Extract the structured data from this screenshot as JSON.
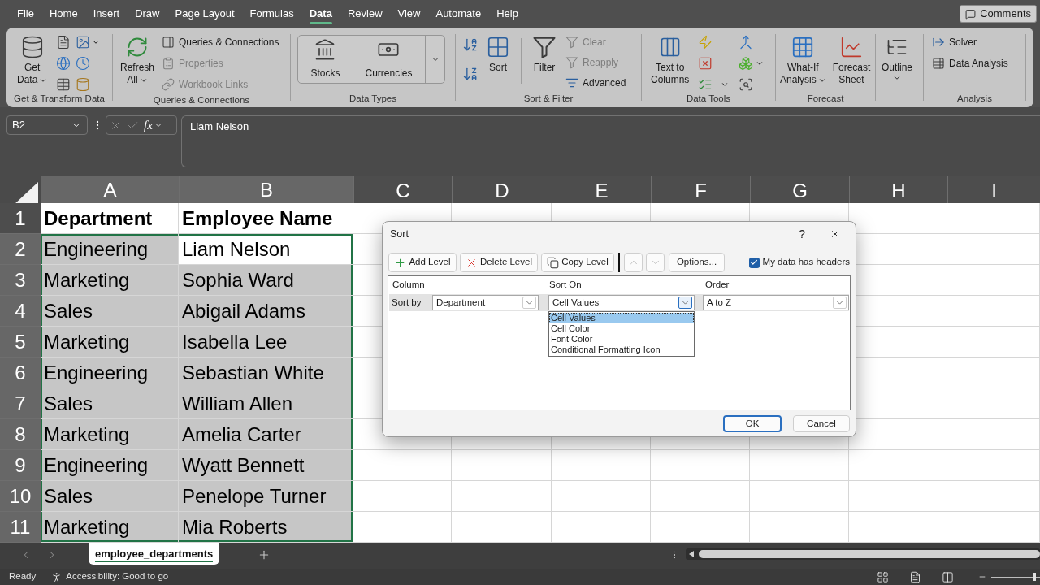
{
  "menu_tabs": [
    {
      "label": "File",
      "selected": false
    },
    {
      "label": "Home",
      "selected": false
    },
    {
      "label": "Insert",
      "selected": false
    },
    {
      "label": "Draw",
      "selected": false
    },
    {
      "label": "Page Layout",
      "selected": false
    },
    {
      "label": "Formulas",
      "selected": false
    },
    {
      "label": "Data",
      "selected": true
    },
    {
      "label": "Review",
      "selected": false
    },
    {
      "label": "View",
      "selected": false
    },
    {
      "label": "Automate",
      "selected": false
    },
    {
      "label": "Help",
      "selected": false
    }
  ],
  "comments_button": "Comments",
  "ribbon": {
    "groups": [
      {
        "label": "Get & Transform Data",
        "buttons": [
          {
            "kind": "large",
            "lines": [
              "Get",
              "Data"
            ],
            "menu": true
          }
        ]
      },
      {
        "label": "Queries & Connections",
        "buttons": [
          {
            "kind": "large",
            "lines": [
              "Refresh",
              "All"
            ],
            "menu": true
          },
          {
            "kind": "small",
            "label": "Queries & Connections",
            "disabled": false
          },
          {
            "kind": "small",
            "label": "Properties",
            "disabled": true
          },
          {
            "kind": "small",
            "label": "Workbook Links",
            "disabled": true
          }
        ]
      },
      {
        "label": "Data Types",
        "buttons": [
          {
            "kind": "gallery",
            "label": "Stocks"
          },
          {
            "kind": "gallery",
            "label": "Currencies"
          }
        ]
      },
      {
        "label": "Sort & Filter",
        "buttons": [
          {
            "kind": "large",
            "lines": [
              "Sort"
            ],
            "menu": false
          },
          {
            "kind": "large",
            "lines": [
              "Filter"
            ],
            "menu": false
          },
          {
            "kind": "small",
            "label": "Clear",
            "disabled": true
          },
          {
            "kind": "small",
            "label": "Reapply",
            "disabled": true
          },
          {
            "kind": "small",
            "label": "Advanced",
            "disabled": false
          }
        ]
      },
      {
        "label": "Data Tools",
        "buttons": [
          {
            "kind": "large",
            "lines": [
              "Text to",
              "Columns"
            ],
            "menu": false
          }
        ]
      },
      {
        "label": "Forecast",
        "buttons": [
          {
            "kind": "large",
            "lines": [
              "What-If",
              "Analysis"
            ],
            "menu": true
          },
          {
            "kind": "large",
            "lines": [
              "Forecast",
              "Sheet"
            ],
            "menu": false
          }
        ]
      },
      {
        "buttons": [
          {
            "kind": "large",
            "lines": [
              "Outline"
            ],
            "menu": true
          }
        ]
      },
      {
        "label": "Analysis",
        "buttons": [
          {
            "kind": "small",
            "label": "Solver"
          },
          {
            "kind": "small",
            "label": "Data Analysis"
          }
        ]
      }
    ]
  },
  "formula_bar": {
    "name_box": "B2",
    "function_label": "fx",
    "value": "Liam Nelson"
  },
  "sheet": {
    "columns": [
      {
        "label": "A",
        "selected": true
      },
      {
        "label": "B",
        "selected": true
      },
      {
        "label": "C",
        "selected": false
      },
      {
        "label": "D",
        "selected": false
      },
      {
        "label": "E",
        "selected": false
      },
      {
        "label": "F",
        "selected": false
      },
      {
        "label": "G",
        "selected": false
      },
      {
        "label": "H",
        "selected": false
      },
      {
        "label": "I",
        "selected": false
      }
    ],
    "rows": [
      {
        "label": "1",
        "kind": "header",
        "selected": false,
        "cells": [
          {
            "text": "Department",
            "selected": false,
            "active": false
          },
          {
            "text": "Employee Name",
            "selected": false,
            "active": false
          }
        ]
      },
      {
        "label": "2",
        "kind": "data",
        "selected": true,
        "cells": [
          {
            "text": "Engineering",
            "selected": true,
            "active": false
          },
          {
            "text": "Liam Nelson",
            "selected": true,
            "active": true
          }
        ]
      },
      {
        "label": "3",
        "kind": "data",
        "selected": true,
        "cells": [
          {
            "text": "Marketing",
            "selected": true,
            "active": false
          },
          {
            "text": "Sophia Ward",
            "selected": true,
            "active": false
          }
        ]
      },
      {
        "label": "4",
        "kind": "data",
        "selected": true,
        "cells": [
          {
            "text": "Sales",
            "selected": true,
            "active": false
          },
          {
            "text": "Abigail Adams",
            "selected": true,
            "active": false
          }
        ]
      },
      {
        "label": "5",
        "kind": "data",
        "selected": true,
        "cells": [
          {
            "text": "Marketing",
            "selected": true,
            "active": false
          },
          {
            "text": "Isabella Lee",
            "selected": true,
            "active": false
          }
        ]
      },
      {
        "label": "6",
        "kind": "data",
        "selected": true,
        "cells": [
          {
            "text": "Engineering",
            "selected": true,
            "active": false
          },
          {
            "text": "Sebastian White",
            "selected": true,
            "active": false
          }
        ]
      },
      {
        "label": "7",
        "kind": "data",
        "selected": true,
        "cells": [
          {
            "text": "Sales",
            "selected": true,
            "active": false
          },
          {
            "text": "William Allen",
            "selected": true,
            "active": false
          }
        ]
      },
      {
        "label": "8",
        "kind": "data",
        "selected": true,
        "cells": [
          {
            "text": "Marketing",
            "selected": true,
            "active": false
          },
          {
            "text": "Amelia Carter",
            "selected": true,
            "active": false
          }
        ]
      },
      {
        "label": "9",
        "kind": "data",
        "selected": true,
        "cells": [
          {
            "text": "Engineering",
            "selected": true,
            "active": false
          },
          {
            "text": "Wyatt Bennett",
            "selected": true,
            "active": false
          }
        ]
      },
      {
        "label": "10",
        "kind": "data",
        "selected": true,
        "cells": [
          {
            "text": "Sales",
            "selected": true,
            "active": false
          },
          {
            "text": "Penelope Turner",
            "selected": true,
            "active": false
          }
        ]
      },
      {
        "label": "11",
        "kind": "data",
        "selected": true,
        "cells": [
          {
            "text": "Marketing",
            "selected": true,
            "active": false
          },
          {
            "text": "Mia Roberts",
            "selected": true,
            "active": false
          }
        ]
      }
    ]
  },
  "sheet_tabs": [
    {
      "label": "employee_departments",
      "selected": true
    }
  ],
  "status_bar": {
    "mode": "Ready",
    "accessibility": "Accessibility: Good to go",
    "zoom_slider": {
      "level": 0.9
    }
  },
  "dialog": {
    "title": "Sort",
    "help": "?",
    "toolbar": [
      {
        "label": "Add Level"
      },
      {
        "label": "Delete Level"
      },
      {
        "label": "Copy Level"
      }
    ],
    "move_up": {
      "disabled": true
    },
    "move_down": {
      "disabled": true
    },
    "options_button": "Options...",
    "headers_checkbox": {
      "label": "My data has headers",
      "checked": true
    },
    "columns": [
      "Column",
      "Sort On",
      "Order"
    ],
    "levels": [
      {
        "label": "Sort by",
        "column": "Department",
        "sort_on": {
          "value": "Cell Values",
          "open": true,
          "options": [
            {
              "label": "Cell Values",
              "selected": true
            },
            {
              "label": "Cell Color",
              "selected": false
            },
            {
              "label": "Font Color",
              "selected": false
            },
            {
              "label": "Conditional Formatting Icon",
              "selected": false
            }
          ]
        },
        "order": "A to Z"
      }
    ],
    "buttons": [
      {
        "label": "OK",
        "default": true
      },
      {
        "label": "Cancel",
        "default": false
      }
    ]
  }
}
